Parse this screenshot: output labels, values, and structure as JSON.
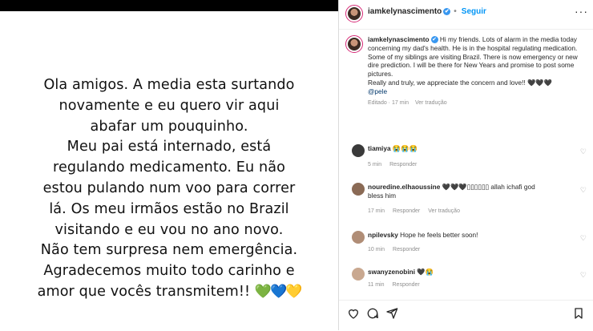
{
  "story": {
    "lines": [
      "Ola amigos. A media esta surtando",
      "novamente e eu quero vir aqui",
      "abafar um pouquinho.",
      "Meu pai está internado, está",
      "regulando medicamento. Eu não",
      "estou pulando num voo para correr",
      "lá. Os meu irmãos estão no Brazil",
      "visitando e eu vou no ano novo.",
      "Não tem surpresa nem emergência.",
      "Agradecemos muito todo carinho e",
      "amor que vocês transmitem!!"
    ],
    "hearts": "💚💙💛"
  },
  "post": {
    "username": "iamkelynascimento",
    "verified_glyph": "✔",
    "follow_label": "Seguir",
    "more_glyph": "···",
    "caption": {
      "username": "iamkelynascimento",
      "text": "Hi my friends. Lots of alarm in the media today concerning my dad's health. He is in the hospital regulating medication. Some of my siblings are visiting Brazil. There is now emergency or new dire prediction. I will be there for New Years and promise to post some pictures.",
      "text2": "Really and truly, we appreciate the concern and love!! 🖤🖤🖤",
      "mention": "@pele",
      "edited": "Editado · 17 min",
      "translate": "Ver tradução"
    }
  },
  "comments": [
    {
      "username": "tiamiya",
      "text": "😭😭😭",
      "time": "5 min",
      "reply": "Responder",
      "translate": ""
    },
    {
      "username": "nouredine.elhaoussine",
      "text": "🖤🖤🖤▯▯▯▯▯▯ allah ichafi god bless him",
      "time": "17 min",
      "reply": "Responder",
      "translate": "Ver tradução"
    },
    {
      "username": "npilevsky",
      "text": "Hope he feels better soon!",
      "time": "10 min",
      "reply": "Responder",
      "translate": ""
    },
    {
      "username": "swanyzenobini",
      "text": "🖤😭",
      "time": "11 min",
      "reply": "Responder",
      "translate": ""
    }
  ],
  "icons": [
    "heart-icon",
    "comment-icon",
    "share-icon",
    "bookmark-icon"
  ],
  "colors": {
    "follow": "#0095f6",
    "verified": "#3897f0",
    "text": "#262626",
    "muted": "#8e8e8e"
  }
}
